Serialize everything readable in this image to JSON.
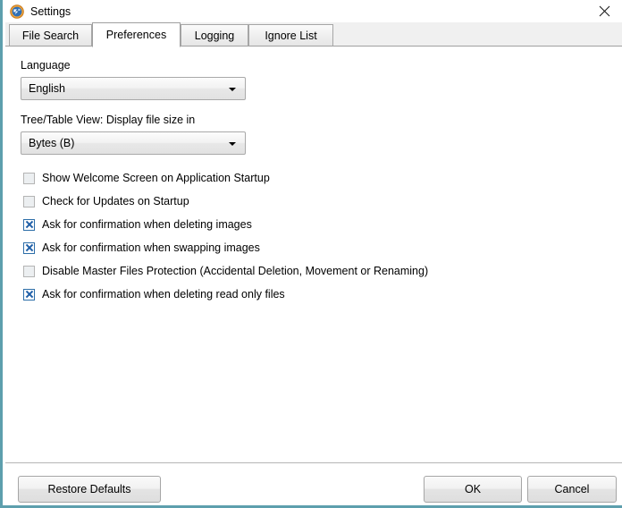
{
  "window": {
    "title": "Settings",
    "icon": "app-icon",
    "close_icon": "close-icon",
    "border_color": "#5d9fad"
  },
  "tabs": [
    {
      "label": "File Search",
      "selected": false
    },
    {
      "label": "Preferences",
      "selected": true
    },
    {
      "label": "Logging",
      "selected": false
    },
    {
      "label": "Ignore List",
      "selected": false
    }
  ],
  "preferences": {
    "language": {
      "label": "Language",
      "value": "English"
    },
    "file_size": {
      "label": "Tree/Table View: Display file size in",
      "value": "Bytes (B)"
    },
    "checkboxes": [
      {
        "label": "Show Welcome Screen on Application Startup",
        "checked": false
      },
      {
        "label": "Check for Updates on Startup",
        "checked": false
      },
      {
        "label": "Ask for confirmation when deleting images",
        "checked": true
      },
      {
        "label": "Ask for confirmation when swapping images",
        "checked": true
      },
      {
        "label": "Disable Master Files Protection (Accidental Deletion, Movement or Renaming)",
        "checked": false
      },
      {
        "label": "Ask for confirmation when deleting read only files",
        "checked": true
      }
    ],
    "check_color": "#1f5fa8"
  },
  "footer": {
    "restore_defaults": "Restore Defaults",
    "ok": "OK",
    "cancel": "Cancel"
  }
}
